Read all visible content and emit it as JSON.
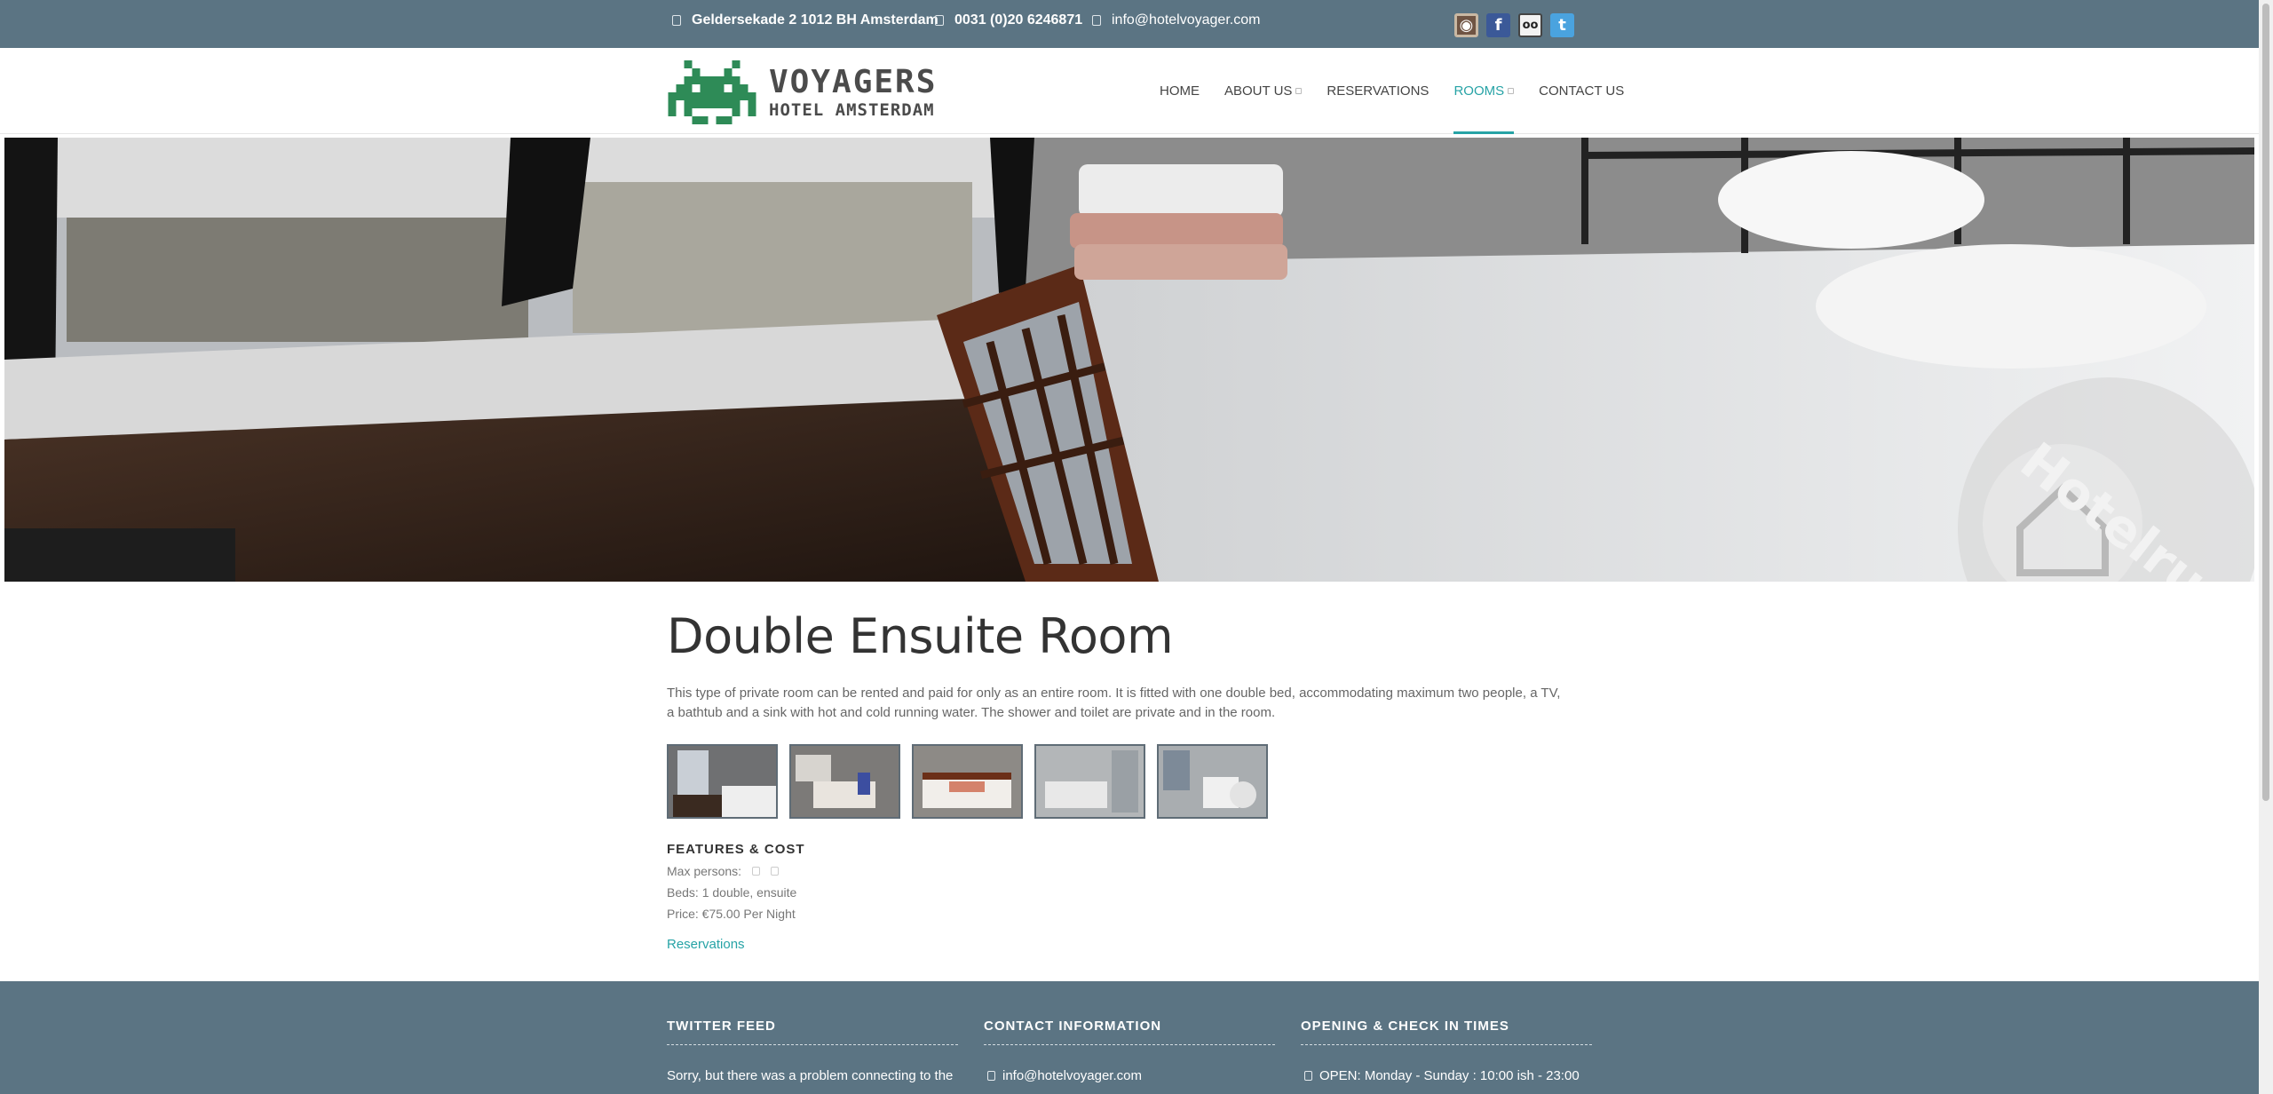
{
  "topbar": {
    "address": "Geldersekade 2 1012 BH Amsterdam",
    "phone": "0031 (0)20 6246871",
    "email": "info@hotelvoyager.com",
    "social": [
      {
        "name": "instagram-icon",
        "glyph": "◉"
      },
      {
        "name": "facebook-icon",
        "glyph": "f"
      },
      {
        "name": "tripadvisor-icon",
        "glyph": "oo"
      },
      {
        "name": "twitter-icon",
        "glyph": "t"
      }
    ]
  },
  "logo": {
    "line1": "VOYAGERS",
    "line2": "HOTEL AMSTERDAM",
    "color": "#2e8b57"
  },
  "nav": {
    "items": [
      {
        "label": "HOME"
      },
      {
        "label": "ABOUT US"
      },
      {
        "label": "RESERVATIONS"
      },
      {
        "label": "ROOMS"
      },
      {
        "label": "CONTACT US"
      }
    ],
    "active_color": "#27a3a6"
  },
  "hero": {
    "watermark": "Hotelrun"
  },
  "room": {
    "title": "Double Ensuite Room",
    "description": "This type of private room can be rented and paid for only as an entire room. It is fitted with one double bed, accommodating maximum two people, a TV, a bathtub and a sink with hot and cold running water. The shower and toilet are private and in the room.",
    "features_heading": "FEATURES & COST",
    "max_persons_label": "Max persons:",
    "beds": "Beds: 1 double, ensuite",
    "price": "Price: €75.00 Per Night",
    "reservations_link": "Reservations"
  },
  "footer": {
    "twitter_heading": "TWITTER FEED",
    "twitter_text": "Sorry, but there was a problem connecting to the",
    "contact_heading": "CONTACT INFORMATION",
    "contact_email": "info@hotelvoyager.com",
    "hours_heading": "OPENING & CHECK IN TIMES",
    "hours_text": "OPEN: Monday - Sunday : 10:00 ish - 23:00"
  }
}
